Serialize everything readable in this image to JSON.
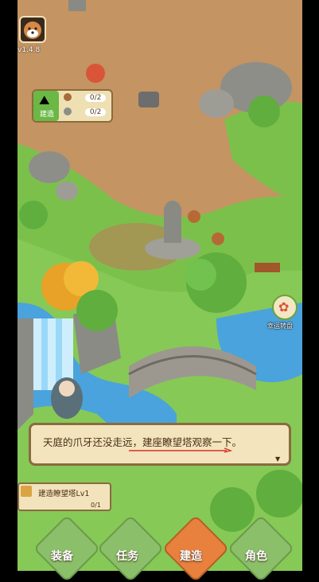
{
  "version": "v1.4.8",
  "build_panel": {
    "label": "建造",
    "resources": [
      {
        "icon": "wood-log-icon",
        "value": "0/2"
      },
      {
        "icon": "stone-icon",
        "value": "0/2"
      }
    ]
  },
  "lucky_wheel": {
    "label": "幸运转盘"
  },
  "dialog": {
    "text": "天庭的爪牙还没走远，建座瞭望塔观察一下。"
  },
  "quest": {
    "title": "建造瞭望塔Lv1",
    "progress": "0/1"
  },
  "nav": [
    {
      "label": "装备"
    },
    {
      "label": "任务"
    },
    {
      "label": "建造"
    },
    {
      "label": "角色"
    }
  ],
  "colors": {
    "accent": "#e07a3a",
    "panel": "#f3e4be",
    "grass": "#6bb845",
    "water": "#4aa3dc"
  }
}
